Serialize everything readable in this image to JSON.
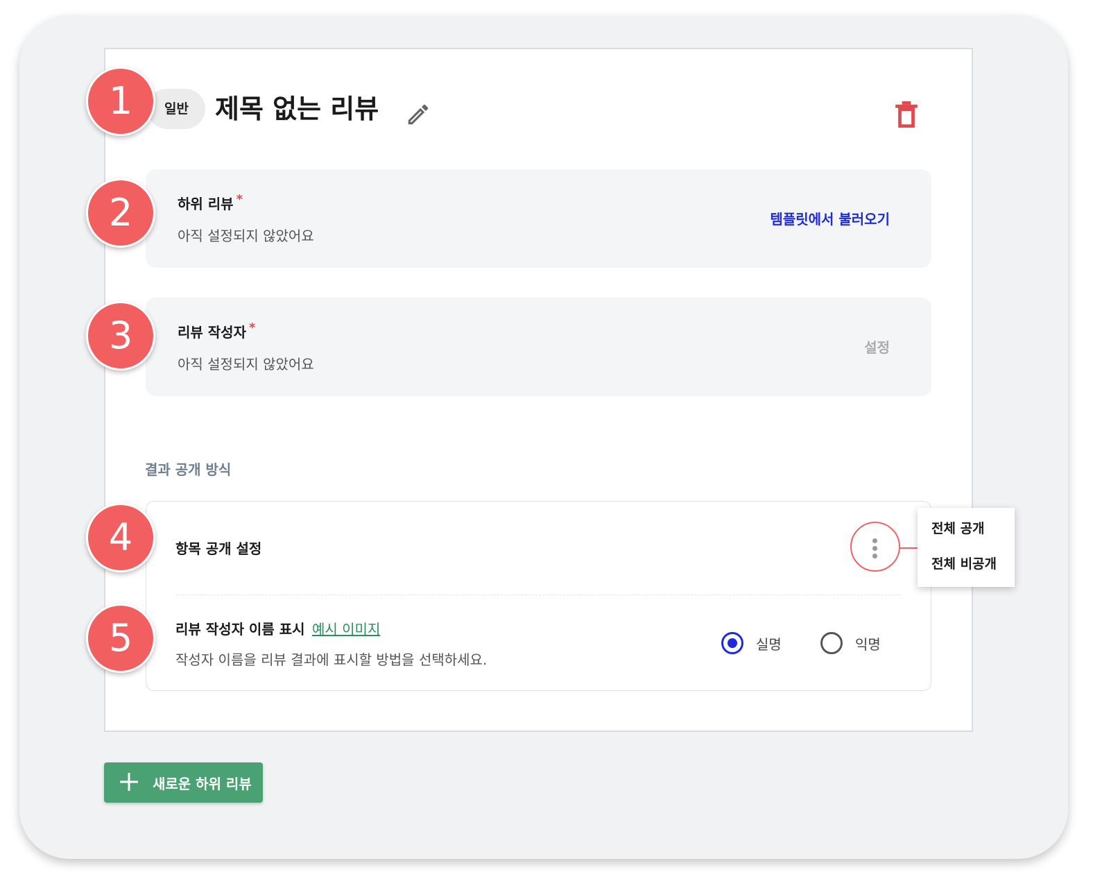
{
  "header": {
    "tag_label": "일반",
    "title": "제목 없는 리뷰",
    "edit_icon": "pencil-icon",
    "delete_icon": "trash-icon",
    "delete_color": "#e4484f"
  },
  "sub_review": {
    "title": "하위 리뷰",
    "required_mark": "*",
    "status": "아직 설정되지 않았어요",
    "action_label": "템플릿에서 불러오기"
  },
  "reviewer": {
    "title": "리뷰 작성자",
    "required_mark": "*",
    "status": "아직 설정되지 않았어요",
    "action_label": "설정"
  },
  "result_section": {
    "heading": "결과 공개 방식",
    "item_visibility": {
      "title": "항목 공개 설정",
      "menu_icon": "kebab-menu-icon",
      "menu_items": [
        "전체 공개",
        "전체 비공개"
      ]
    },
    "name_display": {
      "title": "리뷰 작성자 이름 표시",
      "example_link": "예시 이미지",
      "description": "작성자 이름을 리뷰 결과에 표시할 방법을 선택하세요.",
      "options": [
        {
          "label": "실명",
          "selected": true
        },
        {
          "label": "익명",
          "selected": false
        }
      ]
    }
  },
  "new_button": {
    "label": "새로운 하위 리뷰",
    "icon": "plus-icon"
  },
  "markers": [
    "1",
    "2",
    "3",
    "4",
    "5"
  ],
  "colors": {
    "accent_blue": "#1f2bd8",
    "button_green": "#4aa173",
    "marker_red": "#f25f61",
    "link_green": "#26915b"
  }
}
